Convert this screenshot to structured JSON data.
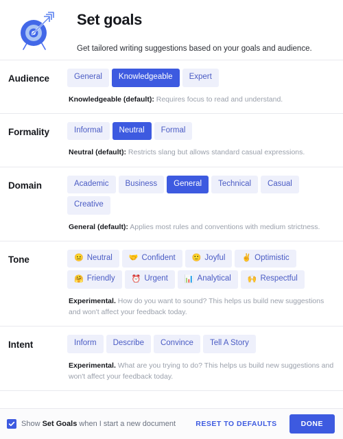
{
  "header": {
    "icon": "target-with-arrow-icon",
    "title": "Set goals",
    "subtitle": "Get tailored writing suggestions based on your goals and audience."
  },
  "colors": {
    "accent": "#3d5ae0",
    "pill_bg": "#eef0fb",
    "pill_text": "#4a5bc4",
    "muted_text": "#9aa0ab",
    "divider": "#e8e9ee",
    "footer_bg": "#fbfbfc"
  },
  "sections": [
    {
      "key": "audience",
      "label": "Audience",
      "options": [
        {
          "label": "General",
          "selected": false
        },
        {
          "label": "Knowledgeable",
          "selected": true
        },
        {
          "label": "Expert",
          "selected": false
        }
      ],
      "desc_strong": "Knowledgeable (default):",
      "desc_rest": " Requires focus to read and understand."
    },
    {
      "key": "formality",
      "label": "Formality",
      "options": [
        {
          "label": "Informal",
          "selected": false
        },
        {
          "label": "Neutral",
          "selected": true
        },
        {
          "label": "Formal",
          "selected": false
        }
      ],
      "desc_strong": "Neutral (default):",
      "desc_rest": " Restricts slang but allows standard casual expressions."
    },
    {
      "key": "domain",
      "label": "Domain",
      "options": [
        {
          "label": "Academic",
          "selected": false
        },
        {
          "label": "Business",
          "selected": false
        },
        {
          "label": "General",
          "selected": true
        },
        {
          "label": "Technical",
          "selected": false
        },
        {
          "label": "Casual",
          "selected": false
        },
        {
          "label": "Creative",
          "selected": false
        }
      ],
      "desc_strong": "General (default):",
      "desc_rest": " Applies most rules and conventions with medium strictness."
    },
    {
      "key": "tone",
      "label": "Tone",
      "options": [
        {
          "label": "Neutral",
          "selected": false,
          "emoji": "😐",
          "icon": "neutral-face-icon"
        },
        {
          "label": "Confident",
          "selected": false,
          "emoji": "🤝",
          "icon": "handshake-icon"
        },
        {
          "label": "Joyful",
          "selected": false,
          "emoji": "🙂",
          "icon": "smiling-face-icon"
        },
        {
          "label": "Optimistic",
          "selected": false,
          "emoji": "✌️",
          "icon": "victory-hand-icon"
        },
        {
          "label": "Friendly",
          "selected": false,
          "emoji": "🤗",
          "icon": "hugging-face-icon"
        },
        {
          "label": "Urgent",
          "selected": false,
          "emoji": "⏰",
          "icon": "alarm-clock-icon"
        },
        {
          "label": "Analytical",
          "selected": false,
          "emoji": "📊",
          "icon": "bar-chart-icon"
        },
        {
          "label": "Respectful",
          "selected": false,
          "emoji": "🙌",
          "icon": "raising-hands-icon"
        }
      ],
      "desc_strong": "Experimental.",
      "desc_rest": " How do you want to sound? This helps us build new suggestions and won't affect your feedback today."
    },
    {
      "key": "intent",
      "label": "Intent",
      "options": [
        {
          "label": "Inform",
          "selected": false
        },
        {
          "label": "Describe",
          "selected": false
        },
        {
          "label": "Convince",
          "selected": false
        },
        {
          "label": "Tell A Story",
          "selected": false
        }
      ],
      "desc_strong": "Experimental.",
      "desc_rest": " What are you trying to do? This helps us build new suggestions and won't affect your feedback today."
    }
  ],
  "footer": {
    "checkbox_checked": true,
    "checkbox_icon": "checkmark-icon",
    "label_pre": "Show ",
    "label_strong": "Set Goals",
    "label_post": " when I start a new document",
    "reset_label": "RESET TO DEFAULTS",
    "done_label": "DONE"
  }
}
